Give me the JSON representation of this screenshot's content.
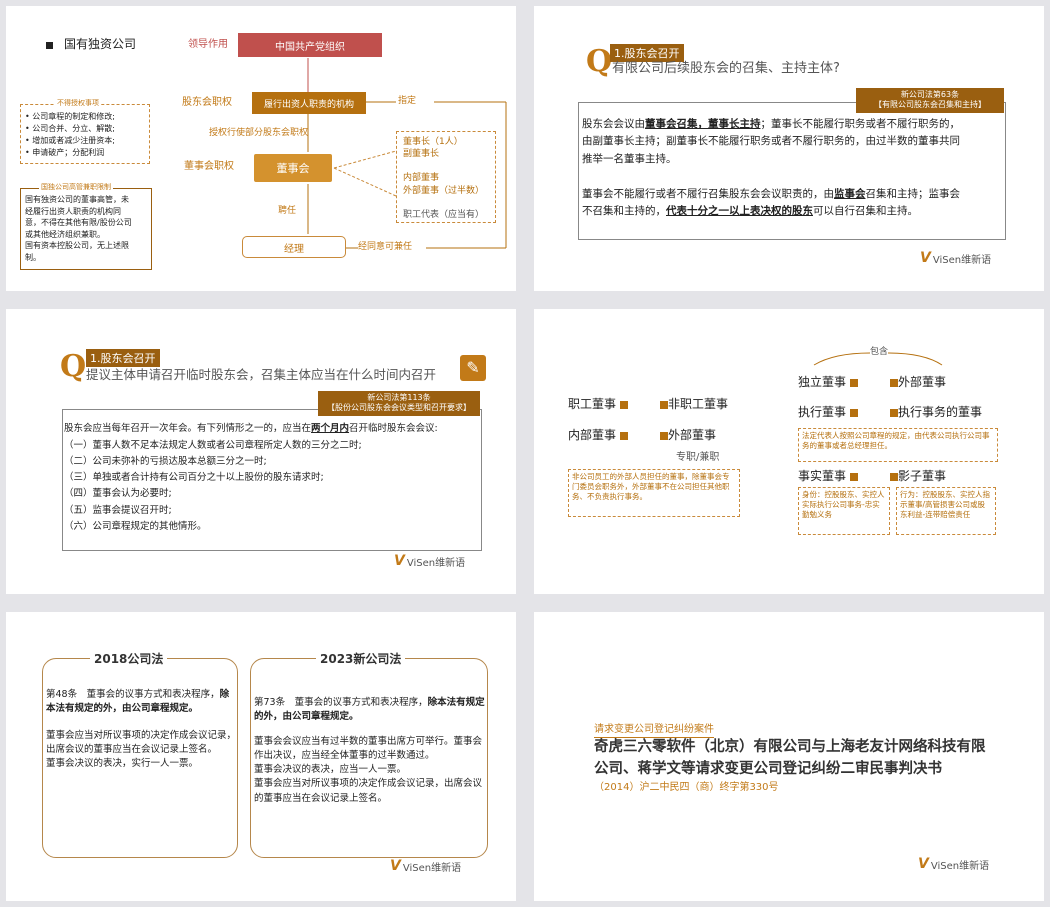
{
  "s1": {
    "bullet_title": "国有独资公司",
    "label_lead": "领导作用",
    "box_party": "中国共产党组织",
    "label_shareholder": "股东会职权",
    "box_investor": "履行出资人职责的机构",
    "label_appoint": "指定",
    "label_authorize": "授权行使部分股东会职权",
    "label_board": "董事会职权",
    "box_board": "董事会",
    "label_hire": "聘任",
    "box_manager": "经理",
    "label_concurrent": "经同意可兼任",
    "not_authorized_title": "不得授权事项",
    "not_authorized_items": [
      "公司章程的制定和修改;",
      "公司合并、分立、解散;",
      "增加或者减少注册资本;",
      "申请破产；分配利润"
    ],
    "board_composition": [
      "董事长（1人）",
      "副董事长",
      "",
      "内部董事",
      "外部董事（过半数）",
      "",
      "职工代表（应当有）"
    ],
    "restrict_title": "国独公司高管兼职限制",
    "restrict_text": [
      "国有独资公司的董事高管，未",
      "经履行出资人职责的机构同",
      "意，不得在其他有限/股份公司",
      "或其他经济组织兼职。",
      "国有资本控股公司，无上述限",
      "制。"
    ]
  },
  "s2": {
    "q_tag": "1.股东会召开",
    "question": "有限公司后续股东会的召集、主持主体?",
    "law_ref": [
      "新公司法第63条",
      "【有限公司股东会召集和主持】"
    ],
    "p1_a": "股东会会议由",
    "p1_b": "董事会召集，董事长主持",
    "p1_c": "；董事长不能履行职务或者不履行职务的，",
    "p1_d": "由副董事长主持；副董事长不能履行职务或者不履行职务的，由过半数的董事共同",
    "p1_e": "推举一名董事主持。",
    "p2_a": "董事会不能履行或者不履行召集股东会会议职责的，由",
    "p2_b": "监事会",
    "p2_c": "召集和主持；监事会",
    "p2_d": "不召集和主持的，",
    "p2_e": "代表十分之一以上表决权的股东",
    "p2_f": "可以自行召集和主持。",
    "logo": "ViSen维新语"
  },
  "s3": {
    "q_tag": "1.股东会召开",
    "question": "提议主体申请召开临时股东会，召集主体应当在什么时间内召开",
    "law_ref": [
      "新公司法第113条",
      "【股份公司股东会会议类型和召开要求】"
    ],
    "intro_a": "股东会应当每年召开一次年会。有下列情形之一的，应当在",
    "intro_b": "两个月内",
    "intro_c": "召开临时股东会会议:",
    "items": [
      "（一）董事人数不足本法规定人数或者公司章程所定人数的三分之二时;",
      "（二）公司未弥补的亏损达股本总额三分之一时;",
      "（三）单独或者合计持有公司百分之十以上股份的股东请求时;",
      "（四）董事会认为必要时;",
      "（五）监事会提议召开时;",
      "（六）公司章程规定的其他情形。"
    ],
    "logo": "ViSen维新语"
  },
  "s4": {
    "employee_director": "职工董事",
    "non_employee_director": "非职工董事",
    "internal_director": "内部董事",
    "external_director": "外部董事",
    "fulltime": "专职/兼职",
    "external_note": "非公司员工的外部人员担任的董事，除董事会专门委员会职务外，外部董事不在公司担任其他职务、不负责执行事务。",
    "include": "包含",
    "independent_director": "独立董事",
    "external_director2": "外部董事",
    "executive_director": "执行董事",
    "exec_affairs_director": "执行事务的董事",
    "exec_note": "法定代表人按照公司章程的规定，由代表公司执行公司事务的董事或者总经理担任。",
    "de_facto_director": "事实董事",
    "shadow_director": "影子董事",
    "identity_note": "身份：控股股东、实控人实际执行公司事务-忠实勤勉义务",
    "behavior_note": "行为：控股股东、实控人指示董事/高管损害公司或股东利益-连带赔偿责任"
  },
  "s5": {
    "title_2018": "2018公司法",
    "text_2018_a": "第48条　董事会的议事方式和表决程序，",
    "text_2018_b": "除本法有规定的外，由公司章程规定。",
    "text_2018_c": "董事会应当对所议事项的决定作成会议记录，出席会议的董事应当在会议记录上签名。",
    "text_2018_d": "董事会决议的表决，实行一人一票。",
    "title_2023": "2023新公司法",
    "text_2023_a": "第73条　董事会的议事方式和表决程序，",
    "text_2023_b": "除本法有规定的外，由公司章程规定。",
    "text_2023_c": "董事会会议应当有过半数的董事出席方可举行。董事会作出决议，应当经全体董事的过半数通过。",
    "text_2023_d": "董事会决议的表决，应当一人一票。",
    "text_2023_e": "董事会应当对所议事项的决定作成会议记录，出席会议的董事应当在会议记录上签名。",
    "logo": "ViSen维新语"
  },
  "s6": {
    "tag": "请求变更公司登记纠纷案件",
    "title_line1": "奇虎三六零软件（北京）有限公司与上海老友计网络科技有限",
    "title_line2": "公司、蒋学文等请求变更公司登记纠纷二审民事判决书",
    "case_no": "（2014）沪二中民四（商）终字第330号",
    "logo": "ViSen维新语"
  }
}
